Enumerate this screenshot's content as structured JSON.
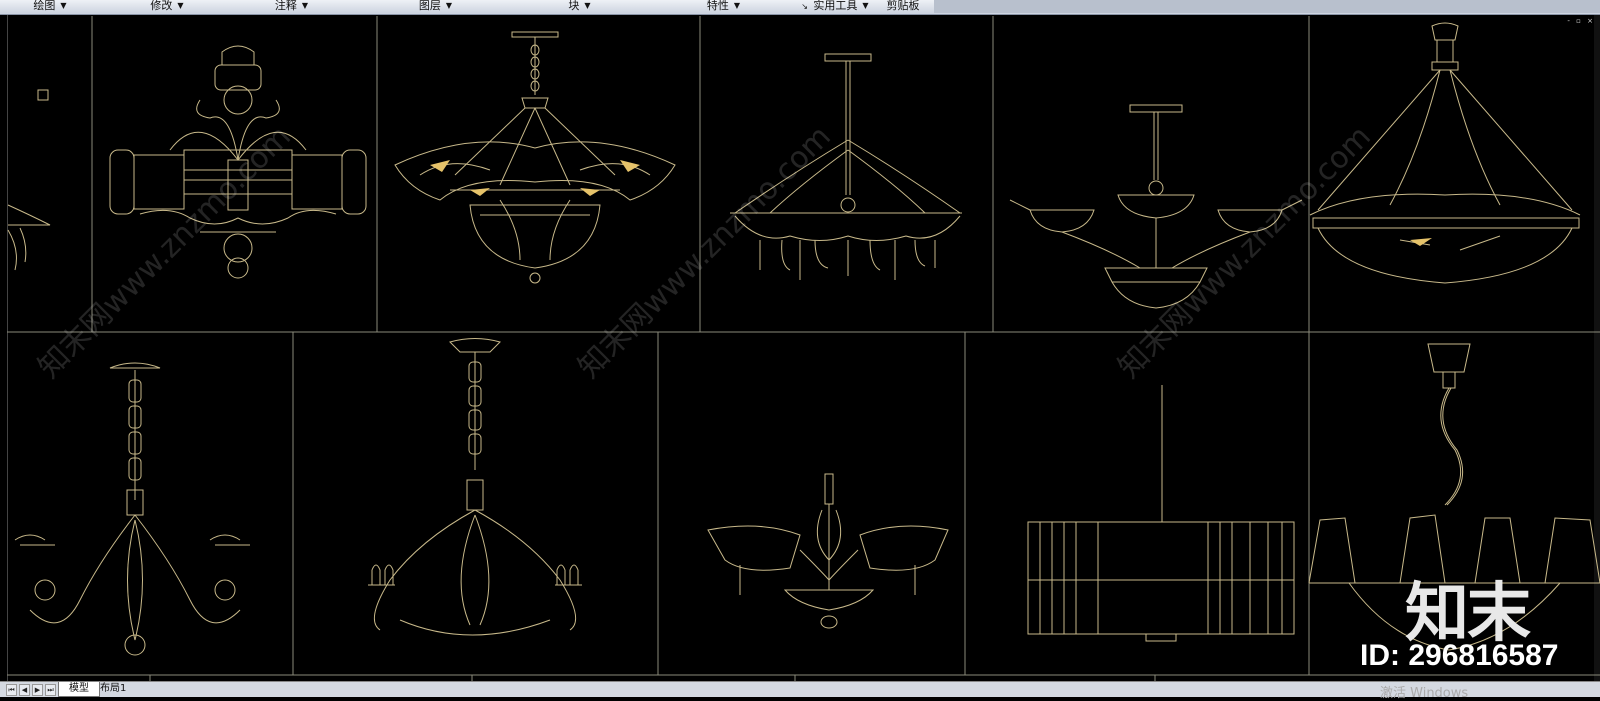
{
  "ribbon": {
    "groups": [
      {
        "label": "绘图",
        "has_arrow": true
      },
      {
        "label": "修改",
        "has_arrow": true
      },
      {
        "label": "注释",
        "has_arrow": true
      },
      {
        "label": "图层",
        "has_arrow": true
      },
      {
        "label": "块",
        "has_arrow": true
      },
      {
        "label": "特性",
        "has_arrow": true
      },
      {
        "label": "实用工具",
        "has_arrow": true
      },
      {
        "label": "剪贴板",
        "has_arrow": false
      }
    ]
  },
  "window_controls": "- ▫ ×",
  "layout_tabs": [
    {
      "label": "模型",
      "active": true
    },
    {
      "label": "布局1",
      "active": false
    }
  ],
  "watermark": {
    "brand": "知末",
    "id_text": "ID: 296816587",
    "diagonal_text": "知末网www.znzmo.com"
  },
  "os_notice": "激活 Windows",
  "colors": {
    "canvas": "#000000",
    "frame_line": "#8a8a7a",
    "drawing_line": "#c8b98a",
    "accent_gold": "#e6c36a"
  }
}
